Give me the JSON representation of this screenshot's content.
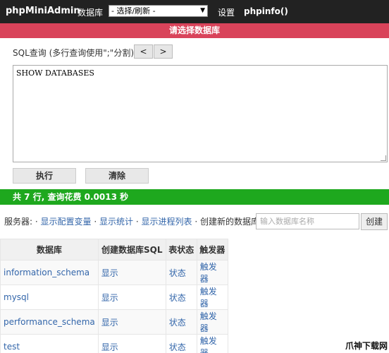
{
  "topbar": {
    "brand": "phpMiniAdmin",
    "db_label": "数据库",
    "db_select_value": "- 选择/刷新 -",
    "settings": "设置",
    "phpinfo": "phpinfo()"
  },
  "banner": "请选择数据库",
  "sql": {
    "label": "SQL查询 (多行查询使用\";\"分割):",
    "prev": "<",
    "next": ">",
    "query": "SHOW DATABASES",
    "run": "执行",
    "clear": "清除"
  },
  "result": "共 7 行, 查询花费 0.0013 秒",
  "server": {
    "label": "服务器:",
    "links": [
      "显示配置变量",
      "显示统计",
      "显示进程列表"
    ],
    "create_label": "创建新的数据库:",
    "input_placeholder": "输入数据库名称",
    "create_button": "创建"
  },
  "table": {
    "headers": [
      "数据库",
      "创建数据库SQL",
      "表状态",
      "触发器"
    ],
    "rows": [
      [
        "information_schema",
        "显示",
        "状态",
        "触发器"
      ],
      [
        "mysql",
        "显示",
        "状态",
        "触发器"
      ],
      [
        "performance_schema",
        "显示",
        "状态",
        "触发器"
      ],
      [
        "test",
        "显示",
        "状态",
        "触发器"
      ]
    ]
  },
  "watermark": "爪神下载网",
  "colors": {
    "topbar": "#222222",
    "banner": "#d9435a",
    "result": "#1ea81e",
    "link": "#3366aa"
  }
}
